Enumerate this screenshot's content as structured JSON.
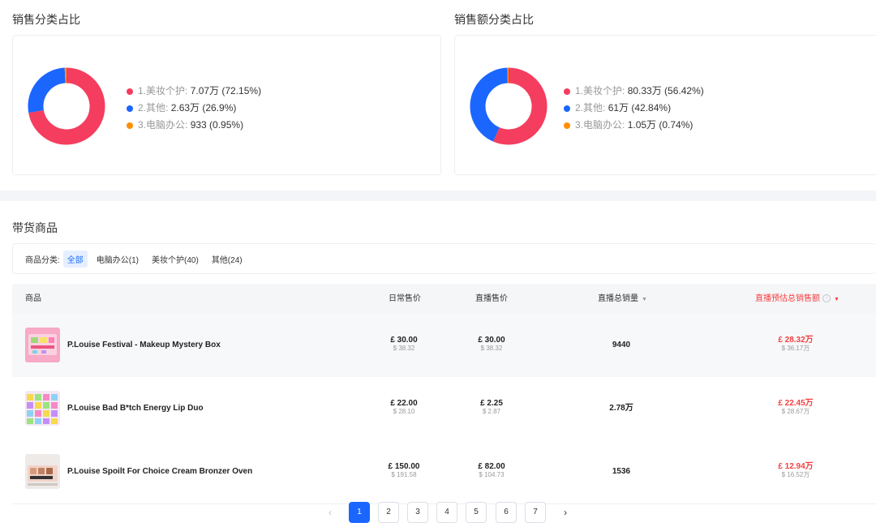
{
  "sales_share": {
    "title": "销售分类占比",
    "items": [
      {
        "name": "1.美妆个护:",
        "value": "7.07万 (72.15%)",
        "color": "#f53d5f",
        "pct": 72.15
      },
      {
        "name": "2.其他:",
        "value": "2.63万 (26.9%)",
        "color": "#1a66ff",
        "pct": 26.9
      },
      {
        "name": "3.电脑办公:",
        "value": "933 (0.95%)",
        "color": "#ff8f00",
        "pct": 0.95
      }
    ]
  },
  "revenue_share": {
    "title": "销售额分类占比",
    "items": [
      {
        "name": "1.美妆个护:",
        "value": "80.33万 (56.42%)",
        "color": "#f53d5f",
        "pct": 56.42
      },
      {
        "name": "2.其他:",
        "value": "61万 (42.84%)",
        "color": "#1a66ff",
        "pct": 42.84
      },
      {
        "name": "3.电脑办公:",
        "value": "1.05万 (0.74%)",
        "color": "#ff8f00",
        "pct": 0.74
      }
    ]
  },
  "products": {
    "title": "带货商品",
    "filter_label": "商品分类:",
    "filters": [
      "全部",
      "电脑办公(1)",
      "美妆个护(40)",
      "其他(24)"
    ],
    "active_filter": "全部",
    "columns": {
      "product": "商品",
      "daily_price": "日常售价",
      "live_price": "直播售价",
      "live_volume": "直播总销量",
      "live_revenue": "直播预估总销售额"
    },
    "rows": [
      {
        "name": "P.Louise Festival - Makeup Mystery Box",
        "daily_price": "£ 30.00",
        "daily_price_usd": "$ 38.32",
        "live_price": "£ 30.00",
        "live_price_usd": "$ 38.32",
        "volume": "9440",
        "revenue": "£ 28.32万",
        "revenue_usd": "$ 36.17万"
      },
      {
        "name": "P.Louise Bad B*tch Energy Lip Duo",
        "daily_price": "£ 22.00",
        "daily_price_usd": "$ 28.10",
        "live_price": "£ 2.25",
        "live_price_usd": "$ 2.87",
        "volume": "2.78万",
        "revenue": "£ 22.45万",
        "revenue_usd": "$ 28.67万"
      },
      {
        "name": "P.Louise Spoilt For Choice Cream Bronzer Oven",
        "daily_price": "£ 150.00",
        "daily_price_usd": "$ 191.58",
        "live_price": "£ 82.00",
        "live_price_usd": "$ 104.73",
        "volume": "1536",
        "revenue": "£ 12.94万",
        "revenue_usd": "$ 16.52万"
      }
    ]
  },
  "pagination": {
    "prev": "‹",
    "next": "›",
    "pages": [
      "1",
      "2",
      "3",
      "4",
      "5",
      "6",
      "7"
    ],
    "current": "1"
  },
  "icons": {
    "sort_down": "▼",
    "info": "i"
  }
}
